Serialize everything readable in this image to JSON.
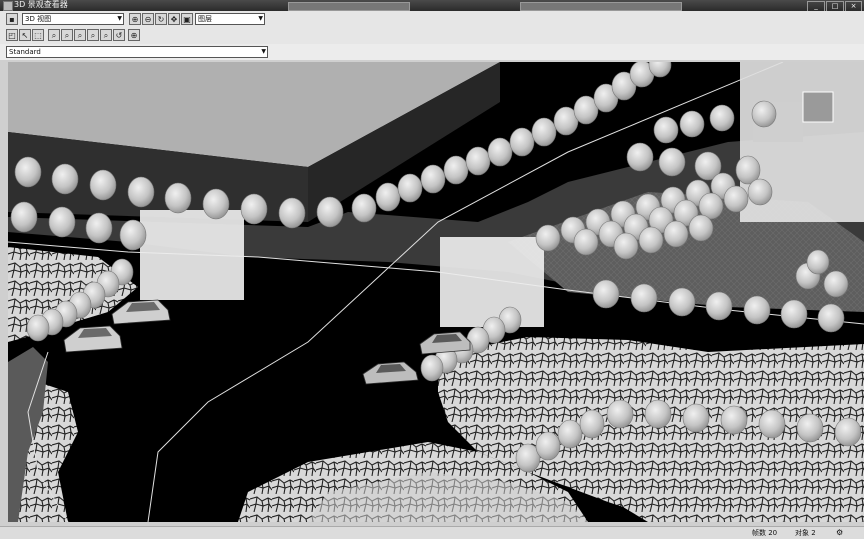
{
  "window": {
    "title": "3D 景观查看器",
    "controls": [
      "_",
      "□",
      "×"
    ]
  },
  "toolbar": {
    "view_combo": "3D 视图",
    "layer_combo": "图层"
  },
  "style_combo": {
    "value": "Standard"
  },
  "status": {
    "left": "",
    "mid": "帧数 20",
    "right": "对象 2"
  },
  "icons": [
    "save-icon",
    "zoom-in-icon",
    "zoom-out-icon",
    "rotate-icon",
    "pan-icon",
    "fit-view-icon",
    "select-icon",
    "orbit-icon",
    "walk-icon",
    "crosshair-icon"
  ],
  "colors": {
    "road": "#000000",
    "grass": "#3a3a3a",
    "sky": "#b0b0b0",
    "pavement": "#5e5e5e",
    "building": "#dedede"
  }
}
